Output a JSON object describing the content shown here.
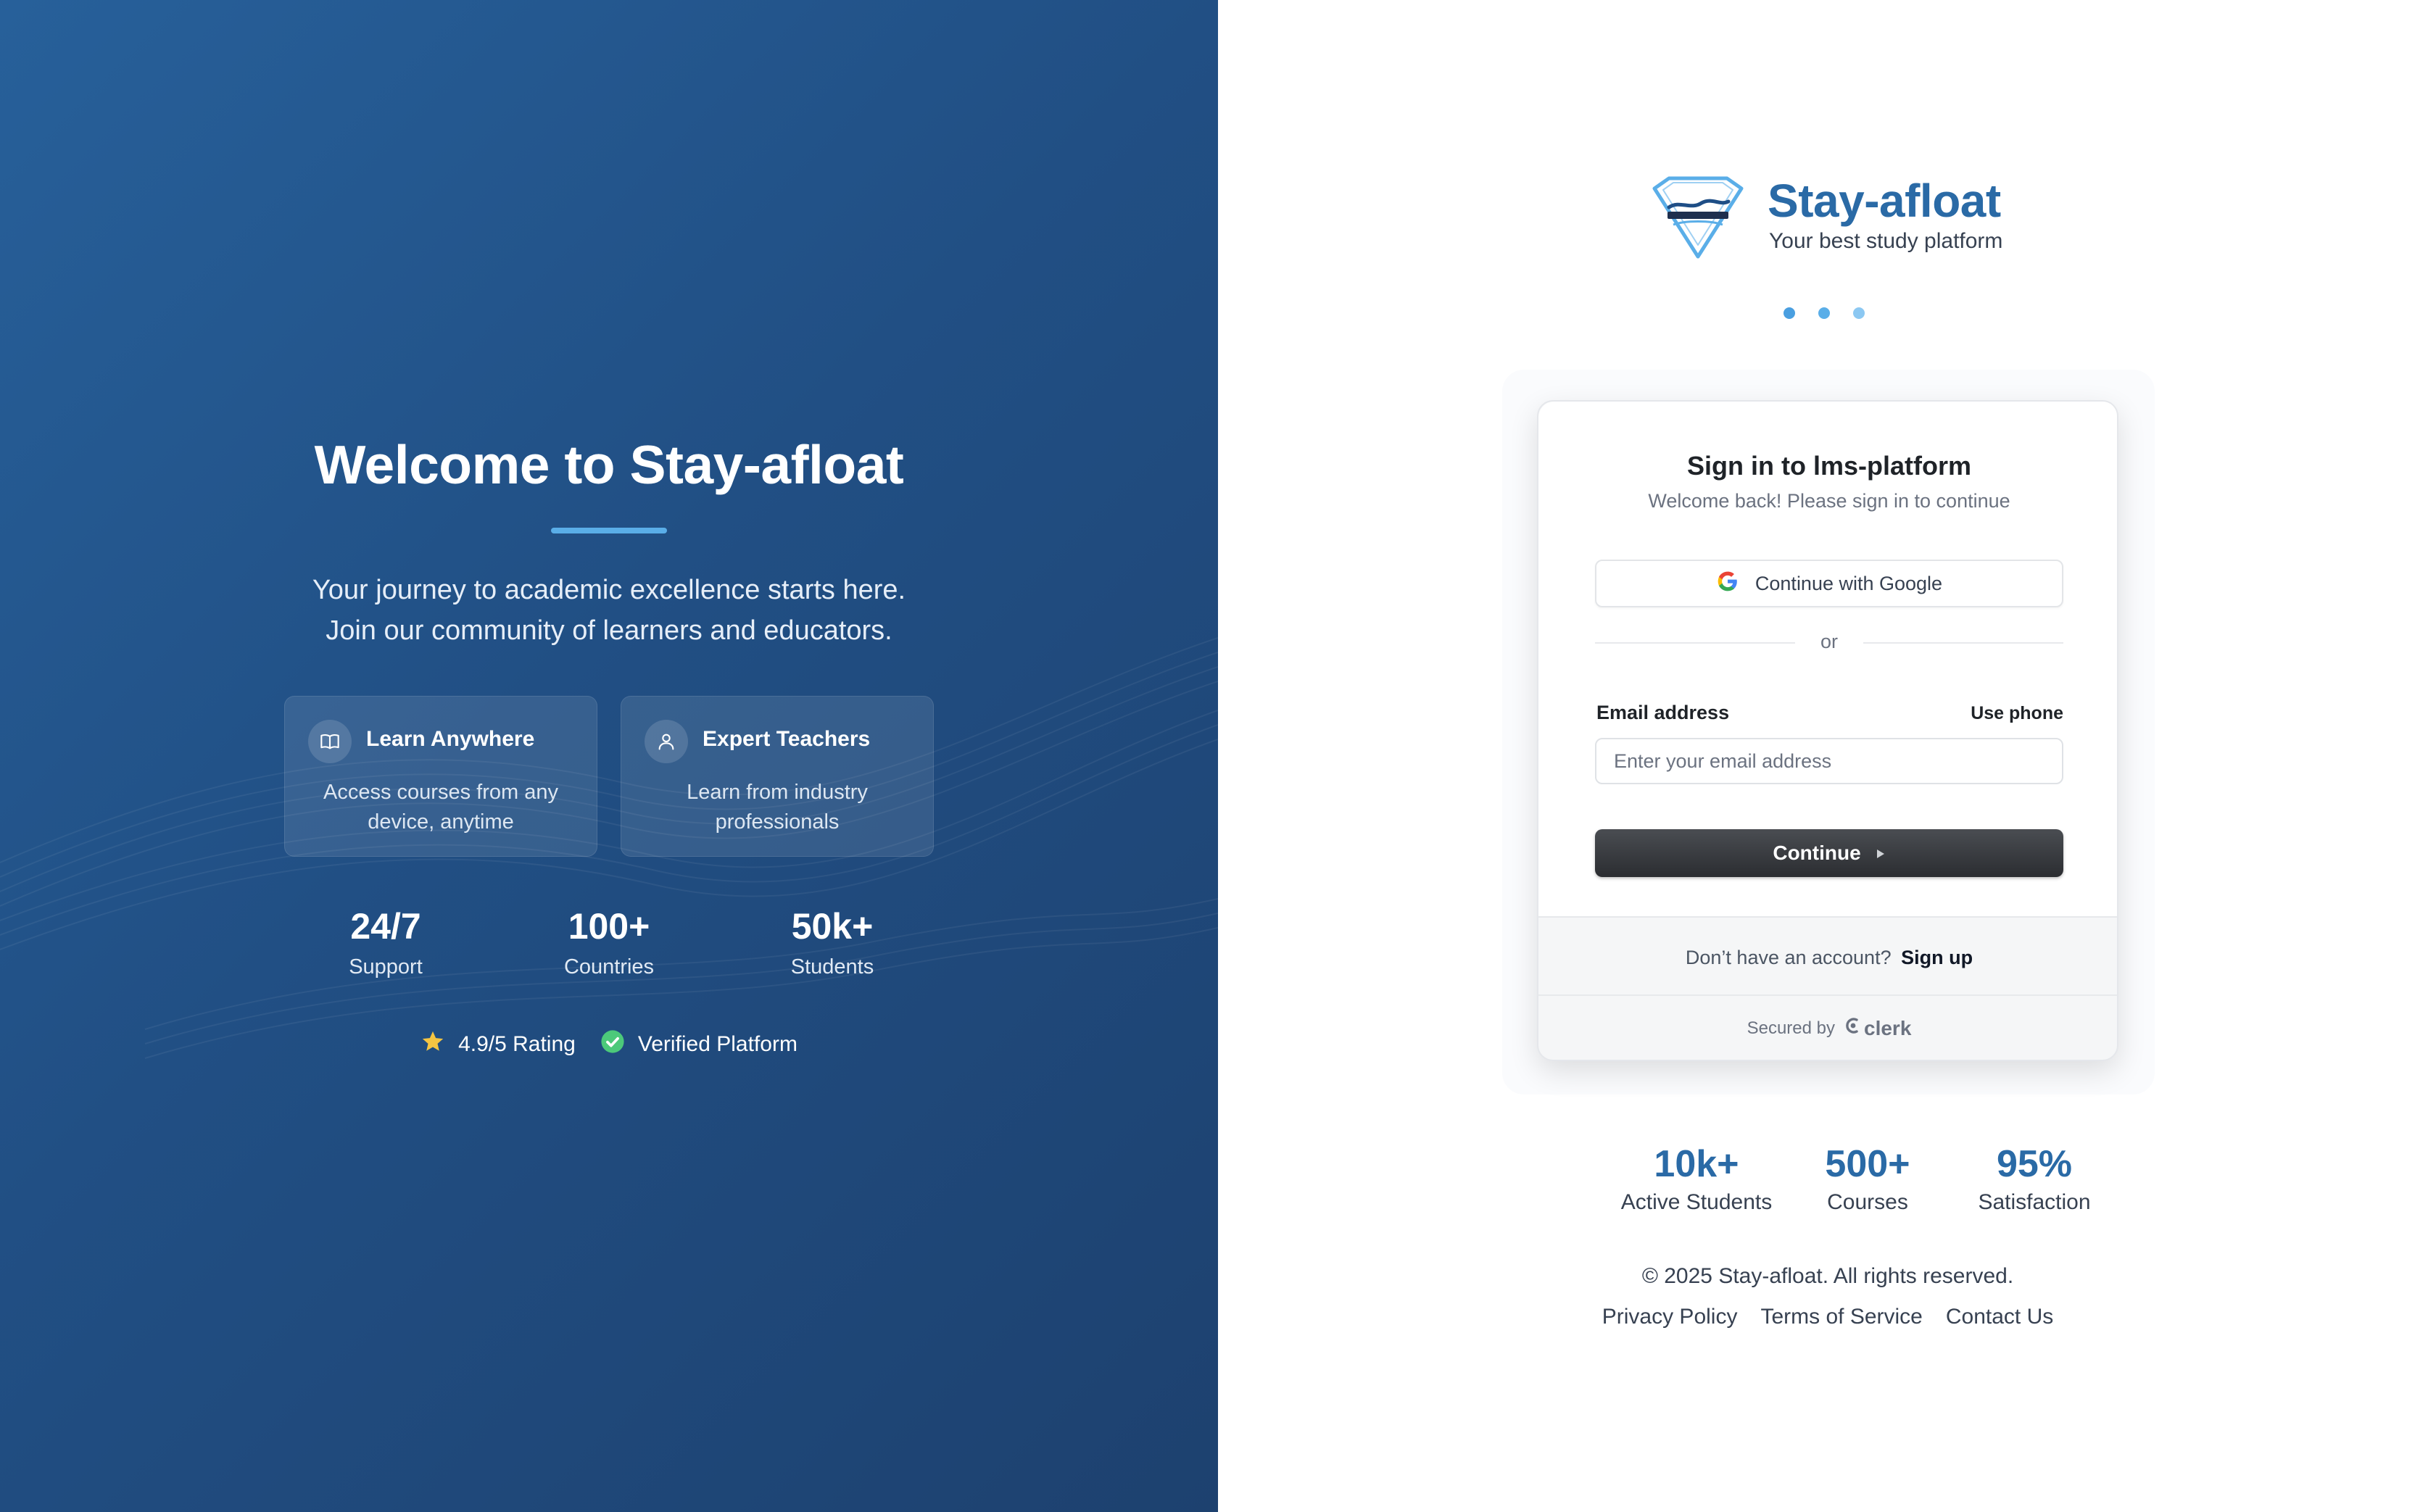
{
  "hero": {
    "title": "Welcome to Stay-afloat",
    "lead_line1": "Your journey to academic excellence starts here.",
    "lead_line2": "Join our community of learners and educators.",
    "features": [
      {
        "icon": "book-icon",
        "title": "Learn Anywhere",
        "desc": "Access courses from any device, anytime"
      },
      {
        "icon": "user-icon",
        "title": "Expert Teachers",
        "desc": "Learn from industry professionals"
      }
    ],
    "stats": [
      {
        "value": "24/7",
        "label": "Support"
      },
      {
        "value": "100+",
        "label": "Countries"
      },
      {
        "value": "50k+",
        "label": "Students"
      }
    ],
    "badges": [
      {
        "icon": "star-icon",
        "text": "4.9/5 Rating"
      },
      {
        "icon": "check-circle-icon",
        "text": "Verified Platform"
      }
    ]
  },
  "brand": {
    "name": "Stay-afloat",
    "tagline": "Your best study platform"
  },
  "signin": {
    "title": "Sign in to lms-platform",
    "subtitle": "Welcome back! Please sign in to continue",
    "google_label": "Continue with Google",
    "divider": "or",
    "email_label": "Email address",
    "use_phone": "Use phone",
    "email_placeholder": "Enter your email address",
    "email_value": "",
    "continue_label": "Continue",
    "no_account": "Don’t have an account?",
    "signup_label": "Sign up",
    "secured_by": "Secured by",
    "clerk_label": "clerk"
  },
  "right_stats": [
    {
      "value": "10k+",
      "label": "Active Students"
    },
    {
      "value": "500+",
      "label": "Courses"
    },
    {
      "value": "95%",
      "label": "Satisfaction"
    }
  ],
  "footer": {
    "copyright": "© 2025 Stay-afloat. All rights reserved.",
    "links": [
      "Privacy Policy",
      "Terms of Service",
      "Contact Us"
    ]
  },
  "colors": {
    "hero_bg": "#214f84",
    "accent": "#5aaee8",
    "brand_blue": "#2a6aa6",
    "star": "#f5c542",
    "verified": "#4cc97a",
    "button_dark": "#2b2d31"
  }
}
